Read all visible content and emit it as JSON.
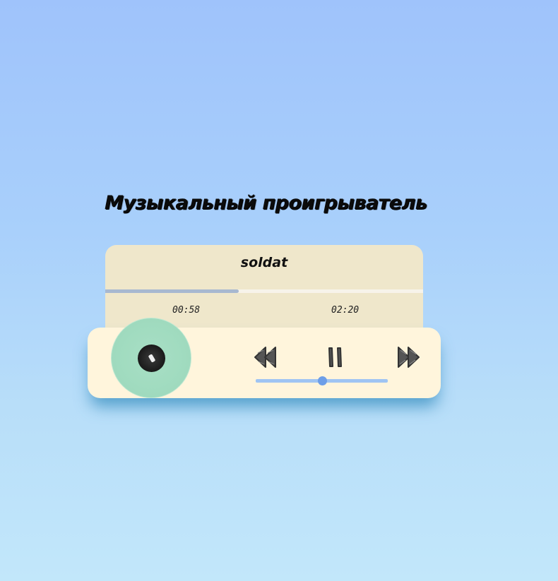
{
  "page": {
    "title": "Музыкальный проигрыватель"
  },
  "track": {
    "title": "soldat",
    "current_time": "00:58",
    "total_time": "02:20",
    "progress_fraction": 0.42
  },
  "controls": {
    "prev_icon": "rewind-icon",
    "play_pause_icon": "pause-icon",
    "next_icon": "fast-forward-icon",
    "state": "playing"
  },
  "volume": {
    "level_fraction": 0.5
  },
  "colors": {
    "background_top": "#9fc3fb",
    "background_bottom": "#c2e7fa",
    "info_card": "#efe7cb",
    "controls_card": "#fff5dc",
    "progress_fill": "#a8b8d0",
    "volume_track": "#9fc4f3",
    "volume_thumb": "#6d9ee8",
    "disc": "#a0dbbf"
  }
}
